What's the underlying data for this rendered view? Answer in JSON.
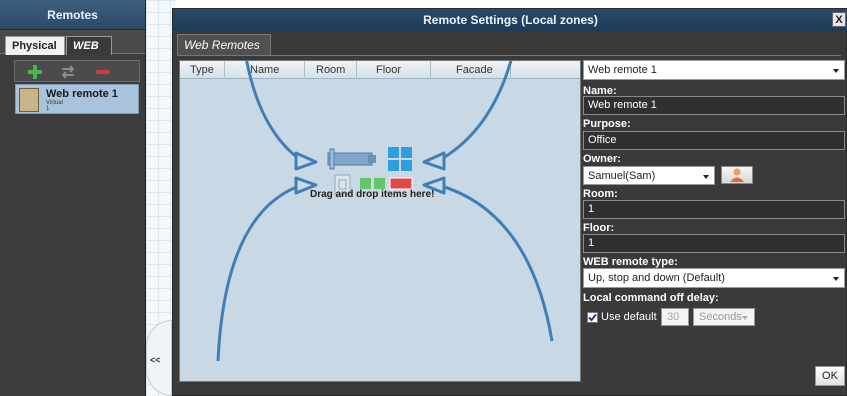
{
  "sidebar": {
    "title": "Remotes",
    "tabs": [
      "Physical",
      "WEB"
    ],
    "toolbar": {
      "add_icon": "plus-icon",
      "swap_icon": "swap-icon",
      "remove_icon": "minus-icon"
    },
    "items": [
      {
        "name": "Web remote 1",
        "sub1": "Virtual",
        "sub2": "1"
      }
    ],
    "collapse_label": "<<"
  },
  "dialog": {
    "title": "Remote Settings (Local zones)",
    "close_label": "X",
    "tab": "Web Remotes",
    "columns": [
      "Type",
      "Name",
      "Room",
      "Floor",
      "Facade"
    ],
    "drop_hint": "Drag and drop items here!"
  },
  "form": {
    "remote_select": "Web remote 1",
    "name_label": "Name:",
    "name_value": "Web remote 1",
    "purpose_label": "Purpose:",
    "purpose_value": "Office",
    "owner_label": "Owner:",
    "owner_value": "Samuel(Sam)",
    "room_label": "Room:",
    "room_value": "1",
    "floor_label": "Floor:",
    "floor_value": "1",
    "type_label": "WEB remote type:",
    "type_value": "Up, stop and down (Default)",
    "delay_label": "Local command off delay:",
    "use_default_label": "Use default",
    "delay_value": "30",
    "delay_unit": "Seconds",
    "ok_label": "OK"
  },
  "colors": {
    "accent": "#2d4a66",
    "drop_area": "#c8d8e4",
    "arrow": "#3e7fb8",
    "selected_item": "#a8c4dc"
  }
}
